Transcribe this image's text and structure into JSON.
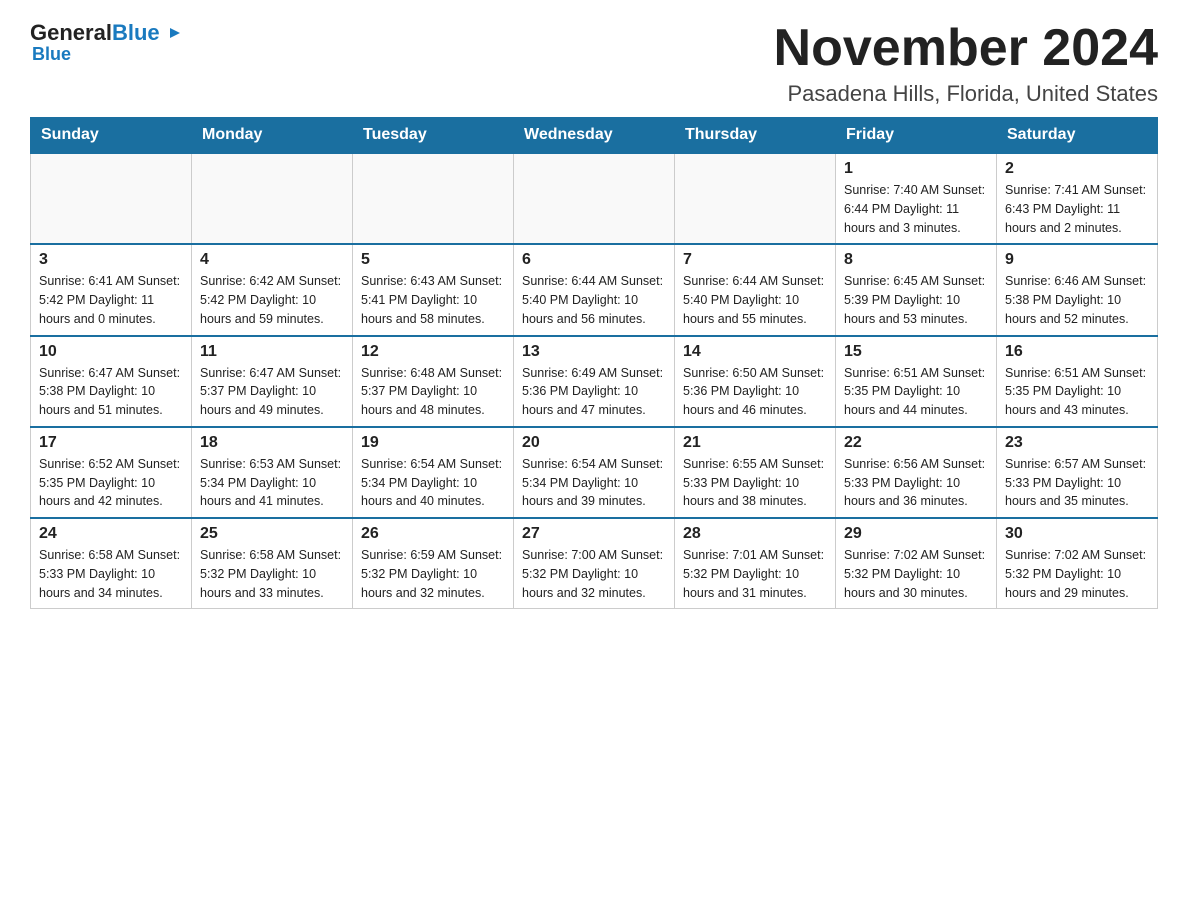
{
  "logo": {
    "general": "General",
    "blue": "Blue",
    "arrow_char": "▶"
  },
  "title": "November 2024",
  "subtitle": "Pasadena Hills, Florida, United States",
  "weekdays": [
    "Sunday",
    "Monday",
    "Tuesday",
    "Wednesday",
    "Thursday",
    "Friday",
    "Saturday"
  ],
  "weeks": [
    [
      {
        "day": "",
        "info": ""
      },
      {
        "day": "",
        "info": ""
      },
      {
        "day": "",
        "info": ""
      },
      {
        "day": "",
        "info": ""
      },
      {
        "day": "",
        "info": ""
      },
      {
        "day": "1",
        "info": "Sunrise: 7:40 AM\nSunset: 6:44 PM\nDaylight: 11 hours and 3 minutes."
      },
      {
        "day": "2",
        "info": "Sunrise: 7:41 AM\nSunset: 6:43 PM\nDaylight: 11 hours and 2 minutes."
      }
    ],
    [
      {
        "day": "3",
        "info": "Sunrise: 6:41 AM\nSunset: 5:42 PM\nDaylight: 11 hours and 0 minutes."
      },
      {
        "day": "4",
        "info": "Sunrise: 6:42 AM\nSunset: 5:42 PM\nDaylight: 10 hours and 59 minutes."
      },
      {
        "day": "5",
        "info": "Sunrise: 6:43 AM\nSunset: 5:41 PM\nDaylight: 10 hours and 58 minutes."
      },
      {
        "day": "6",
        "info": "Sunrise: 6:44 AM\nSunset: 5:40 PM\nDaylight: 10 hours and 56 minutes."
      },
      {
        "day": "7",
        "info": "Sunrise: 6:44 AM\nSunset: 5:40 PM\nDaylight: 10 hours and 55 minutes."
      },
      {
        "day": "8",
        "info": "Sunrise: 6:45 AM\nSunset: 5:39 PM\nDaylight: 10 hours and 53 minutes."
      },
      {
        "day": "9",
        "info": "Sunrise: 6:46 AM\nSunset: 5:38 PM\nDaylight: 10 hours and 52 minutes."
      }
    ],
    [
      {
        "day": "10",
        "info": "Sunrise: 6:47 AM\nSunset: 5:38 PM\nDaylight: 10 hours and 51 minutes."
      },
      {
        "day": "11",
        "info": "Sunrise: 6:47 AM\nSunset: 5:37 PM\nDaylight: 10 hours and 49 minutes."
      },
      {
        "day": "12",
        "info": "Sunrise: 6:48 AM\nSunset: 5:37 PM\nDaylight: 10 hours and 48 minutes."
      },
      {
        "day": "13",
        "info": "Sunrise: 6:49 AM\nSunset: 5:36 PM\nDaylight: 10 hours and 47 minutes."
      },
      {
        "day": "14",
        "info": "Sunrise: 6:50 AM\nSunset: 5:36 PM\nDaylight: 10 hours and 46 minutes."
      },
      {
        "day": "15",
        "info": "Sunrise: 6:51 AM\nSunset: 5:35 PM\nDaylight: 10 hours and 44 minutes."
      },
      {
        "day": "16",
        "info": "Sunrise: 6:51 AM\nSunset: 5:35 PM\nDaylight: 10 hours and 43 minutes."
      }
    ],
    [
      {
        "day": "17",
        "info": "Sunrise: 6:52 AM\nSunset: 5:35 PM\nDaylight: 10 hours and 42 minutes."
      },
      {
        "day": "18",
        "info": "Sunrise: 6:53 AM\nSunset: 5:34 PM\nDaylight: 10 hours and 41 minutes."
      },
      {
        "day": "19",
        "info": "Sunrise: 6:54 AM\nSunset: 5:34 PM\nDaylight: 10 hours and 40 minutes."
      },
      {
        "day": "20",
        "info": "Sunrise: 6:54 AM\nSunset: 5:34 PM\nDaylight: 10 hours and 39 minutes."
      },
      {
        "day": "21",
        "info": "Sunrise: 6:55 AM\nSunset: 5:33 PM\nDaylight: 10 hours and 38 minutes."
      },
      {
        "day": "22",
        "info": "Sunrise: 6:56 AM\nSunset: 5:33 PM\nDaylight: 10 hours and 36 minutes."
      },
      {
        "day": "23",
        "info": "Sunrise: 6:57 AM\nSunset: 5:33 PM\nDaylight: 10 hours and 35 minutes."
      }
    ],
    [
      {
        "day": "24",
        "info": "Sunrise: 6:58 AM\nSunset: 5:33 PM\nDaylight: 10 hours and 34 minutes."
      },
      {
        "day": "25",
        "info": "Sunrise: 6:58 AM\nSunset: 5:32 PM\nDaylight: 10 hours and 33 minutes."
      },
      {
        "day": "26",
        "info": "Sunrise: 6:59 AM\nSunset: 5:32 PM\nDaylight: 10 hours and 32 minutes."
      },
      {
        "day": "27",
        "info": "Sunrise: 7:00 AM\nSunset: 5:32 PM\nDaylight: 10 hours and 32 minutes."
      },
      {
        "day": "28",
        "info": "Sunrise: 7:01 AM\nSunset: 5:32 PM\nDaylight: 10 hours and 31 minutes."
      },
      {
        "day": "29",
        "info": "Sunrise: 7:02 AM\nSunset: 5:32 PM\nDaylight: 10 hours and 30 minutes."
      },
      {
        "day": "30",
        "info": "Sunrise: 7:02 AM\nSunset: 5:32 PM\nDaylight: 10 hours and 29 minutes."
      }
    ]
  ]
}
